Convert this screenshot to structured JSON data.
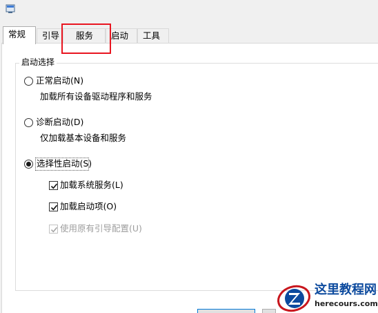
{
  "tabs": [
    {
      "label": "常规",
      "active": true
    },
    {
      "label": "引导",
      "active": false
    },
    {
      "label": "服务",
      "active": false
    },
    {
      "label": "启动",
      "active": false
    },
    {
      "label": "工具",
      "active": false
    }
  ],
  "startup_group": {
    "title": "启动选择",
    "normal": {
      "label": "正常启动(N)",
      "description": "加载所有设备驱动程序和服务",
      "checked": false
    },
    "diagnostic": {
      "label": "诊断启动(D)",
      "description": "仅加载基本设备和服务",
      "checked": false
    },
    "selective": {
      "label": "选择性启动(S)",
      "checked": true,
      "options": [
        {
          "label": "加载系统服务(L)",
          "checked": true,
          "enabled": true
        },
        {
          "label": "加载启动项(O)",
          "checked": true,
          "enabled": true
        },
        {
          "label": "使用原有引导配置(U)",
          "checked": true,
          "enabled": false
        }
      ]
    }
  },
  "colors": {
    "highlight": "#e8141f",
    "watermark_blue": "#0c4a9e"
  },
  "watermark": {
    "name": "这里教程网",
    "url": "herecours.com"
  }
}
